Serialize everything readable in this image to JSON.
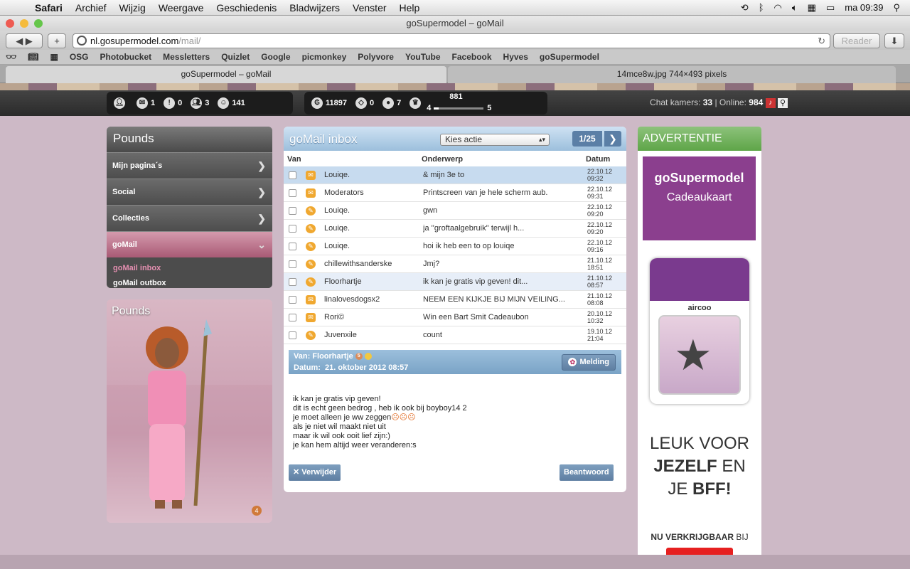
{
  "menubar": {
    "app": "Safari",
    "items": [
      "Archief",
      "Wijzig",
      "Weergave",
      "Geschiedenis",
      "Bladwijzers",
      "Venster",
      "Help"
    ],
    "clock": "ma 09:39"
  },
  "window": {
    "title": "goSupermodel – goMail"
  },
  "toolbar": {
    "url_host": "nl.gosupermodel.com",
    "url_path": "/mail/",
    "reader_label": "Reader"
  },
  "bookmarks": [
    "OSG",
    "Photobucket",
    "Messletters",
    "Quizlet",
    "Google",
    "picmonkey",
    "Polyvore",
    "YouTube",
    "Facebook",
    "Hyves",
    "goSupermodel"
  ],
  "tabs": [
    {
      "label": "goSupermodel – goMail"
    },
    {
      "label": "14mce8w.jpg 744×493 pixels"
    }
  ],
  "stats": {
    "mail": "1",
    "alerts": "0",
    "friends": "3",
    "smiley": "141",
    "coins": "11897",
    "diamonds": "0",
    "pearls": "7",
    "level_points": "881",
    "level_from": "4",
    "level_to": "5",
    "level_progress": 0.1
  },
  "chat": {
    "rooms_label": "Chat kamers:",
    "rooms": "33",
    "online_label": "Online:",
    "online": "984"
  },
  "sidebar": {
    "title": "Pounds",
    "items": [
      {
        "label": "Mijn pagina´s"
      },
      {
        "label": "Social"
      },
      {
        "label": "Collecties"
      },
      {
        "label": "goMail"
      }
    ],
    "subitems": [
      {
        "label": "goMail inbox"
      },
      {
        "label": "goMail outbox"
      }
    ]
  },
  "pounds_card": {
    "title": "Pounds",
    "level": "4"
  },
  "inbox": {
    "title": "goMail inbox",
    "action_select": "Kies actie",
    "pager": "1/25",
    "columns": {
      "from": "Van",
      "subject": "Onderwerp",
      "date": "Datum"
    },
    "rows": [
      {
        "from": "Louiqe.",
        "subject": "& mijn 3e to",
        "date": "22.10.12",
        "time": "09:32"
      },
      {
        "from": "Moderators",
        "subject": "Printscreen van je hele scherm aub.",
        "date": "22.10.12",
        "time": "09:31"
      },
      {
        "from": "Louiqe.",
        "subject": "gwn",
        "date": "22.10.12",
        "time": "09:20"
      },
      {
        "from": "Louiqe.",
        "subject": "ja ''groftaalgebruik'' terwijl h...",
        "date": "22.10.12",
        "time": "09:20"
      },
      {
        "from": "Louiqe.",
        "subject": "hoi ik heb een to op louiqe",
        "date": "22.10.12",
        "time": "09:16"
      },
      {
        "from": "chillewithsanderske",
        "subject": "Jmj?",
        "date": "21.10.12",
        "time": "18:51"
      },
      {
        "from": "Floorhartje",
        "subject": "ik kan je gratis vip geven! dit...",
        "date": "21.10.12",
        "time": "08:57"
      },
      {
        "from": "linalovesdogsx2",
        "subject": "NEEM EEN KIJKJE BIJ MIJN VEILING...",
        "date": "21.10.12",
        "time": "08:08"
      },
      {
        "from": "Rori©",
        "subject": "Win een Bart Smit Cadeaubon",
        "date": "20.10.12",
        "time": "10:32"
      },
      {
        "from": "Juvenxile",
        "subject": "count",
        "date": "19.10.12",
        "time": "21:04"
      }
    ],
    "message": {
      "from_label": "Van:",
      "from": "Floorhartje",
      "from_level": "5",
      "date_label": "Datum:",
      "date": "21. oktober 2012 08:57",
      "report_label": "Melding",
      "body": [
        "ik kan je gratis vip geven!",
        "dit is echt geen bedrog , heb ik ook bij boyboy14 2",
        "je moet alleen je ww zeggen",
        "als je niet wil maakt niet uit",
        "maar ik wil ook ooit lief zijn:)",
        "je kan hem altijd weer veranderen:s"
      ],
      "delete_label": "Verwijder",
      "reply_label": "Beantwoord"
    }
  },
  "ad": {
    "header": "ADVERTENTIE",
    "brand": "goSupermodel",
    "subtitle": "Cadeaukaart",
    "card_brand": "aircoo",
    "line1": "LEUK VOOR",
    "line2a": "JEZELF",
    "line2b": "EN",
    "line3a": "JE",
    "line3b": "BFF!",
    "footer_a": "NU VERKRIJGBAAR",
    "footer_b": "BIJ"
  },
  "colors": {
    "inbox_blue": "#5b7fa6",
    "ad_green": "#5ea548",
    "ad_purple": "#8b3f8e",
    "page_bg": "#cdb9c6",
    "gomail_pink": "#a85a75"
  }
}
